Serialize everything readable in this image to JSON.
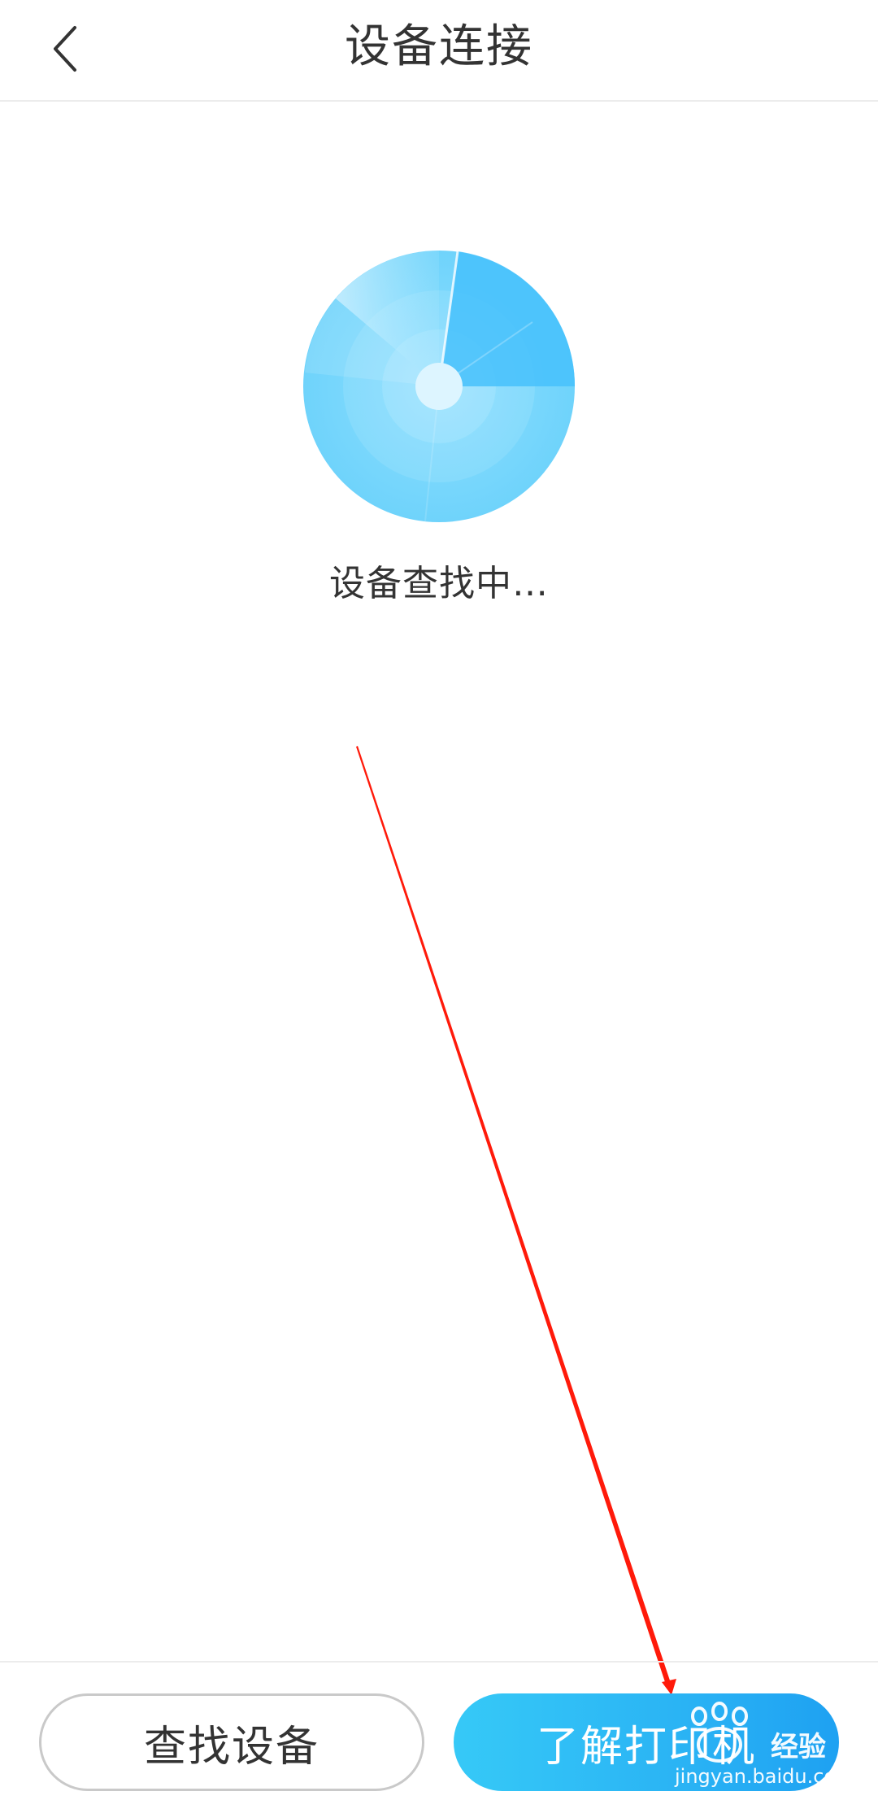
{
  "header": {
    "title": "设备连接",
    "back_icon": "chevron-left-icon"
  },
  "scanner": {
    "icon": "radar-scan-icon",
    "status": "设备查找中…"
  },
  "footer": {
    "find_button_label": "查找设备",
    "learn_button_label": "了解打印机"
  },
  "watermark": {
    "brand": "经验",
    "url": "jingyan.baidu.com"
  },
  "colors": {
    "accent": "#2ab3f4",
    "annotation_arrow": "#ff1a0a"
  }
}
